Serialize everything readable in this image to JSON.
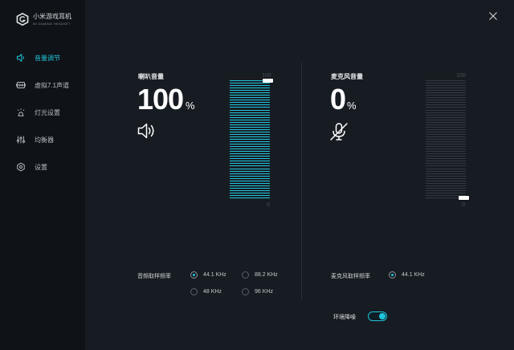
{
  "app": {
    "name": "小米游戏耳机",
    "subtitle": "MI GAMING HEADSET"
  },
  "nav": {
    "items": [
      {
        "label": "音量调节",
        "icon": "speaker-icon",
        "active": true
      },
      {
        "label": "虚拟7.1声道",
        "icon": "surround-icon",
        "active": false
      },
      {
        "label": "灯光设置",
        "icon": "lamp-icon",
        "active": false
      },
      {
        "label": "均衡器",
        "icon": "equalizer-icon",
        "active": false
      },
      {
        "label": "设置",
        "icon": "gear-icon",
        "active": false
      }
    ]
  },
  "speaker": {
    "label": "喇叭音量",
    "value": "100",
    "unit": "%",
    "scale_max": "100",
    "scale_min": "0",
    "level": 1.0,
    "rate_label": "音频取样频率",
    "rates": [
      {
        "label": "44.1 KHz",
        "selected": true
      },
      {
        "label": "88.2 KHz",
        "selected": false
      },
      {
        "label": "48 KHz",
        "selected": false
      },
      {
        "label": "96 KHz",
        "selected": false
      }
    ]
  },
  "mic": {
    "label": "麦克风音量",
    "value": "0",
    "unit": "%",
    "scale_max": "100",
    "scale_min": "0",
    "level": 0.0,
    "rate_label": "麦克风取样频率",
    "rates": [
      {
        "label": "44.1 KHz",
        "selected": true
      }
    ]
  },
  "noise_cancel": {
    "label": "环境降噪",
    "enabled": true
  },
  "colors": {
    "accent": "#20c4dc",
    "sidebar": "#0f1317",
    "main": "#171c22",
    "meter_off": "#343a42"
  }
}
